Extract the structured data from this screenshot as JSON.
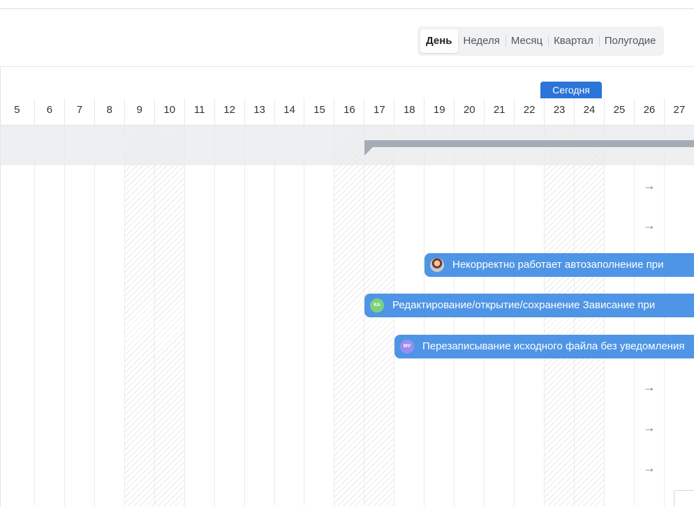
{
  "view_switch": {
    "options": [
      "День",
      "Неделя",
      "Месяц",
      "Квартал",
      "Полугодие"
    ],
    "active": "День"
  },
  "today_label": "Сегодня",
  "days": [
    "5",
    "6",
    "7",
    "8",
    "9",
    "10",
    "11",
    "12",
    "13",
    "14",
    "15",
    "16",
    "17",
    "18",
    "19",
    "20",
    "21",
    "22",
    "23",
    "24",
    "25",
    "26",
    "27"
  ],
  "weekend_days": [
    "9",
    "10",
    "16",
    "17",
    "23",
    "24"
  ],
  "arrow_glyph": "→",
  "tasks": [
    {
      "title": "Некорректно работает автозаполнение при",
      "avatar": "",
      "avatar_kind": "photo"
    },
    {
      "title": "Редактирование/открытие/сохранение Зависание при",
      "avatar": "КА",
      "avatar_kind": "initials"
    },
    {
      "title": "Перезаписывание исходного файла без уведомления",
      "avatar": "МУ",
      "avatar_kind": "initials"
    }
  ],
  "colors": {
    "accent": "#2b74d8",
    "task_bar": "#4f95e6",
    "summary_bar": "#a4adb6"
  }
}
